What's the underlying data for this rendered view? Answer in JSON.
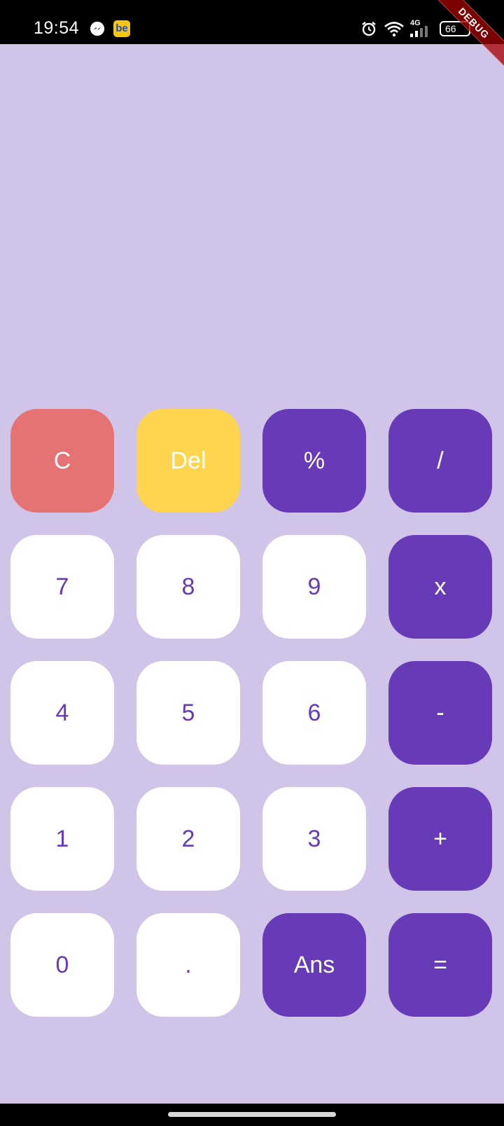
{
  "status_bar": {
    "time": "19:54",
    "network_label": "4G",
    "battery_level": "66",
    "icons": [
      "messenger-icon",
      "be-app-icon",
      "alarm-icon",
      "wifi-icon",
      "signal-icon",
      "battery-icon"
    ],
    "be_app_text": "be"
  },
  "debug_banner": "DEBUG",
  "display": {
    "question": "",
    "answer": ""
  },
  "colors": {
    "background": "#D1C4E9",
    "operator": "#673AB7",
    "number_key": "#FFFFFF",
    "clear_key": "#E57373",
    "delete_key": "#FFD54F"
  },
  "keys": [
    {
      "label": "C",
      "type": "clear"
    },
    {
      "label": "Del",
      "type": "delete"
    },
    {
      "label": "%",
      "type": "op"
    },
    {
      "label": "/",
      "type": "op"
    },
    {
      "label": "7",
      "type": "num"
    },
    {
      "label": "8",
      "type": "num"
    },
    {
      "label": "9",
      "type": "num"
    },
    {
      "label": "x",
      "type": "op"
    },
    {
      "label": "4",
      "type": "num"
    },
    {
      "label": "5",
      "type": "num"
    },
    {
      "label": "6",
      "type": "num"
    },
    {
      "label": "-",
      "type": "op"
    },
    {
      "label": "1",
      "type": "num"
    },
    {
      "label": "2",
      "type": "num"
    },
    {
      "label": "3",
      "type": "num"
    },
    {
      "label": "+",
      "type": "op"
    },
    {
      "label": "0",
      "type": "num"
    },
    {
      "label": ".",
      "type": "num"
    },
    {
      "label": "Ans",
      "type": "op"
    },
    {
      "label": "=",
      "type": "op"
    }
  ]
}
